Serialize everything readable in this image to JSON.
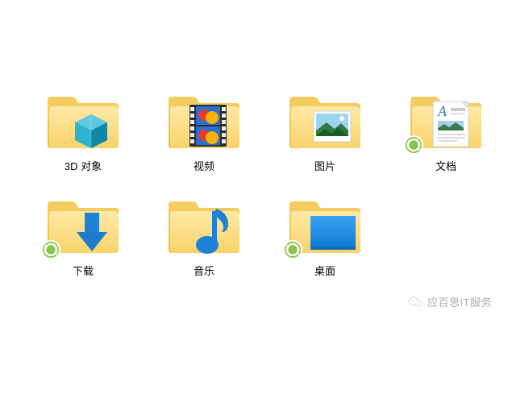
{
  "folders": [
    {
      "id": "3d-objects",
      "label": "3D 对象",
      "sync": false
    },
    {
      "id": "videos",
      "label": "视频",
      "sync": false
    },
    {
      "id": "pictures",
      "label": "图片",
      "sync": false
    },
    {
      "id": "documents",
      "label": "文档",
      "sync": true
    },
    {
      "id": "downloads",
      "label": "下载",
      "sync": true
    },
    {
      "id": "music",
      "label": "音乐",
      "sync": false
    },
    {
      "id": "desktop",
      "label": "桌面",
      "sync": true
    }
  ],
  "watermark": {
    "text": "应百思IT服务"
  }
}
